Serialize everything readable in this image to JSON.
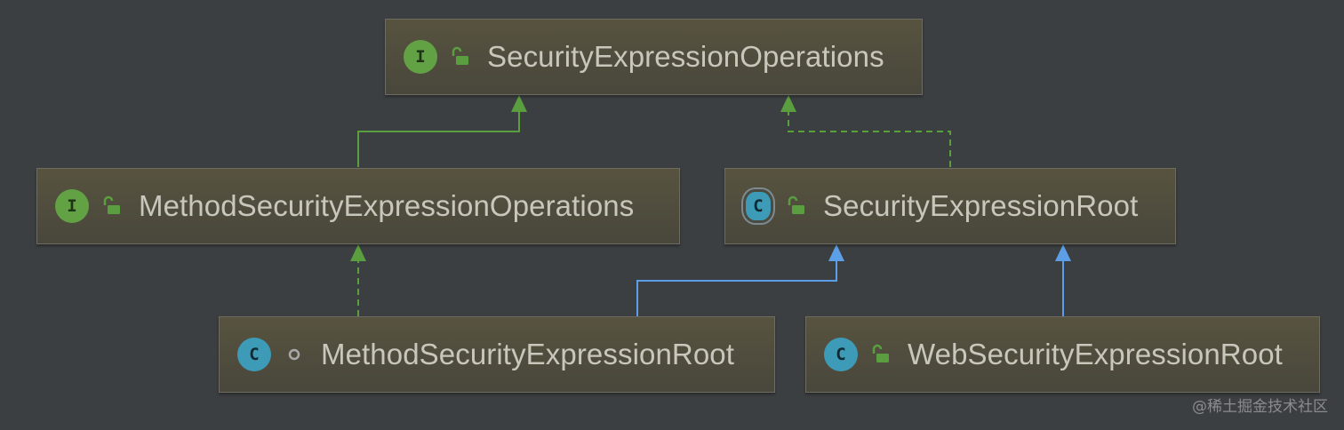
{
  "colors": {
    "background": "#3c3f41",
    "interface_icon": "#62a244",
    "class_icon": "#3d9bb7",
    "implements_edge": "#5a9e3f",
    "extends_edge": "#5c9fe6"
  },
  "nodes": {
    "security_expression_operations": {
      "label": "SecurityExpressionOperations",
      "kind": "interface",
      "kind_letter": "I",
      "visibility": "public-lock-icon"
    },
    "method_security_expression_operations": {
      "label": "MethodSecurityExpressionOperations",
      "kind": "interface",
      "kind_letter": "I",
      "visibility": "public-lock-icon"
    },
    "security_expression_root": {
      "label": "SecurityExpressionRoot",
      "kind": "abstract-class",
      "kind_letter": "C",
      "visibility": "public-lock-icon"
    },
    "method_security_expression_root": {
      "label": "MethodSecurityExpressionRoot",
      "kind": "class",
      "kind_letter": "C",
      "visibility": "package-private-dot-icon"
    },
    "web_security_expression_root": {
      "label": "WebSecurityExpressionRoot",
      "kind": "class",
      "kind_letter": "C",
      "visibility": "public-lock-icon"
    }
  },
  "edges": [
    {
      "from": "MethodSecurityExpressionOperations",
      "to": "SecurityExpressionOperations",
      "relation": "extends-interface",
      "style": "solid-green"
    },
    {
      "from": "SecurityExpressionRoot",
      "to": "SecurityExpressionOperations",
      "relation": "implements",
      "style": "dashed-green"
    },
    {
      "from": "MethodSecurityExpressionRoot",
      "to": "MethodSecurityExpressionOperations",
      "relation": "implements",
      "style": "dashed-green"
    },
    {
      "from": "MethodSecurityExpressionRoot",
      "to": "SecurityExpressionRoot",
      "relation": "extends",
      "style": "solid-blue"
    },
    {
      "from": "WebSecurityExpressionRoot",
      "to": "SecurityExpressionRoot",
      "relation": "extends",
      "style": "solid-blue"
    }
  ],
  "watermark": "@稀土掘金技术社区"
}
